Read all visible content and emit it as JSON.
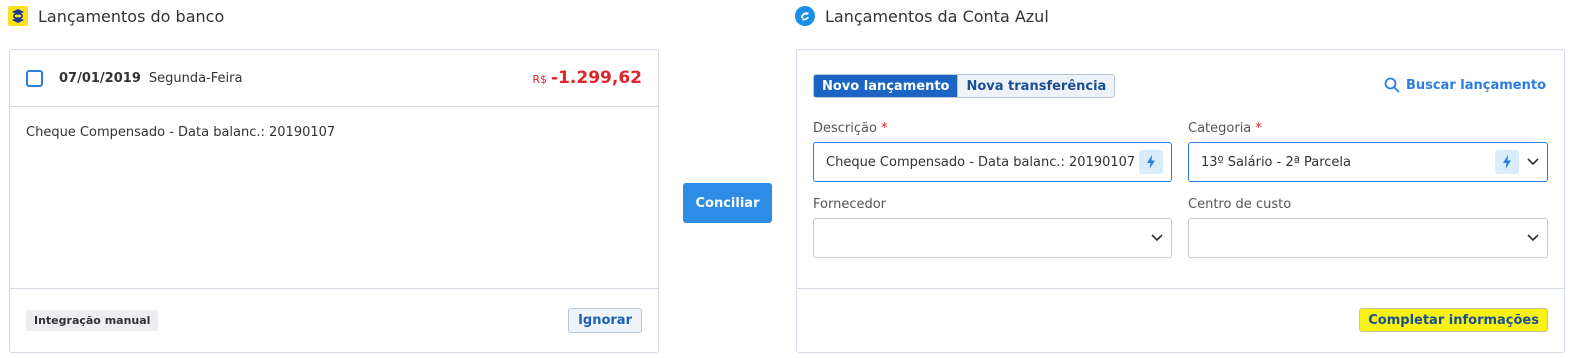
{
  "bank": {
    "title": "Lançamentos do banco",
    "date": "07/01/2019",
    "weekday": "Segunda-Feira",
    "currency": "R$",
    "amount": "-1.299,62",
    "description": "Cheque Compensado - Data balanc.: 20190107",
    "tag": "Integração manual",
    "ignore_label": "Ignorar"
  },
  "conciliar_label": "Conciliar",
  "conta_azul": {
    "title": "Lançamentos da Conta Azul",
    "tabs": [
      {
        "label": "Novo lançamento",
        "active": true
      },
      {
        "label": "Nova transferência",
        "active": false
      }
    ],
    "search_label": "Buscar lançamento",
    "descricao": {
      "label": "Descrição",
      "value": "Cheque Compensado - Data balanc.: 20190107"
    },
    "categoria": {
      "label": "Categoria",
      "value": "13º Salário - 2ª Parcela"
    },
    "fornecedor": {
      "label": "Fornecedor",
      "value": ""
    },
    "centro_custo": {
      "label": "Centro de custo",
      "value": ""
    },
    "required_mark": "*",
    "complete_label": "Completar informações"
  },
  "colors": {
    "accent": "#2d8de6",
    "negative": "#e0242b",
    "highlight": "#f7f214"
  },
  "icons": [
    "banco-do-brasil-logo-icon",
    "conta-azul-logo-icon",
    "search-icon",
    "lightning-icon",
    "chevron-down-icon"
  ]
}
